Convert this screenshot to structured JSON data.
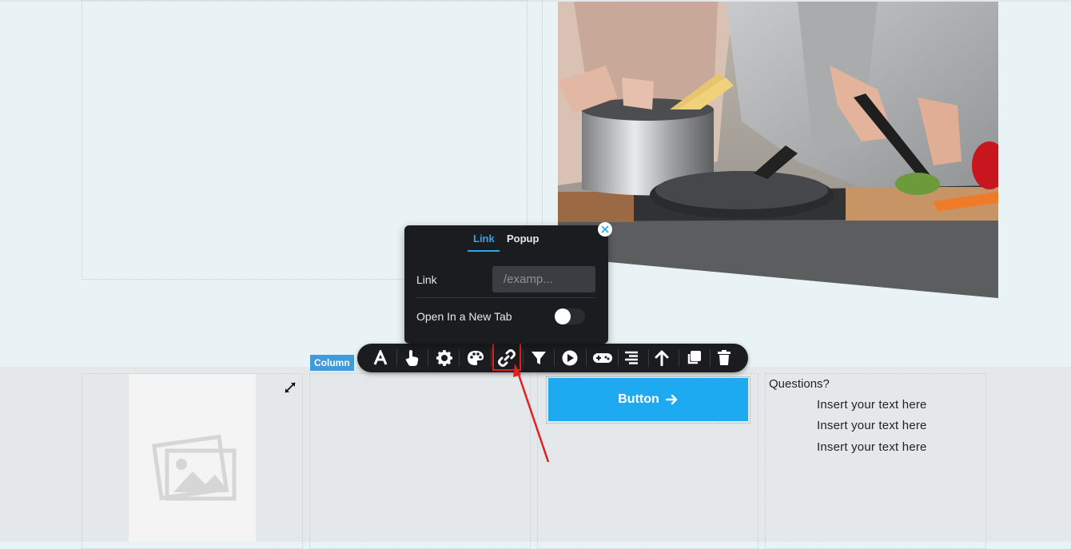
{
  "link_popover": {
    "tabs": [
      {
        "label": "Link",
        "active": true
      },
      {
        "label": "Popup",
        "active": false
      }
    ],
    "link_label": "Link",
    "link_placeholder": "/examp...",
    "link_value": "",
    "new_tab_label": "Open In a New Tab",
    "new_tab_enabled": false
  },
  "column_label": "Column",
  "toolbar": {
    "icons": [
      "typography-icon",
      "pointer-hand-icon",
      "gear-icon",
      "palette-icon",
      "link-icon",
      "filter-icon",
      "play-icon",
      "gamepad-icon",
      "align-right-icon",
      "arrow-up-icon",
      "duplicate-icon",
      "trash-icon"
    ],
    "active": "link-icon"
  },
  "cta_button": {
    "label": "Button",
    "color": "#1eaaf1"
  },
  "questions": {
    "title": "Questions?",
    "lines": [
      "Insert your text here",
      "Insert your text here",
      "Insert your text here"
    ]
  },
  "colors": {
    "accent": "#2aa8e6",
    "highlight": "#e02020",
    "toolbar_bg": "#1b1c1f"
  }
}
